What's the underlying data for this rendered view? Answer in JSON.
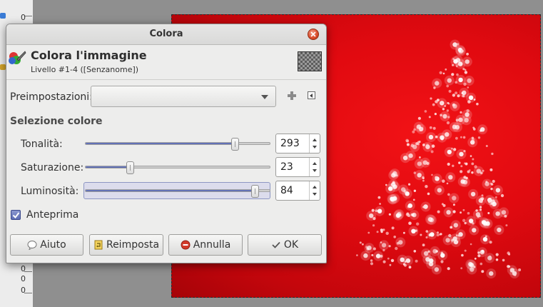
{
  "ruler": {
    "labels": [
      "0",
      "0",
      "0",
      "0"
    ]
  },
  "dialog": {
    "title": "Colora",
    "header_title": "Colora l'immagine",
    "header_subtitle": "Livello #1-4 ([Senzanome])",
    "presets_label": "Preimpostazioni:",
    "presets_value": "",
    "section_title": "Selezione colore",
    "sliders": [
      {
        "label": "Tonalità:",
        "value": "293",
        "fraction": 0.81
      },
      {
        "label": "Saturazione:",
        "value": "23",
        "fraction": 0.24
      },
      {
        "label": "Luminosità:",
        "value": "84",
        "fraction": 0.92
      }
    ],
    "preview_label": "Anteprima",
    "buttons": {
      "help": "Aiuto",
      "reset": "Reimposta",
      "cancel": "Annulla",
      "ok": "OK"
    }
  },
  "colors": {
    "canvas_red": "#e10a10",
    "slider_fill": "#5d6db4",
    "close_button": "#d94a28"
  }
}
